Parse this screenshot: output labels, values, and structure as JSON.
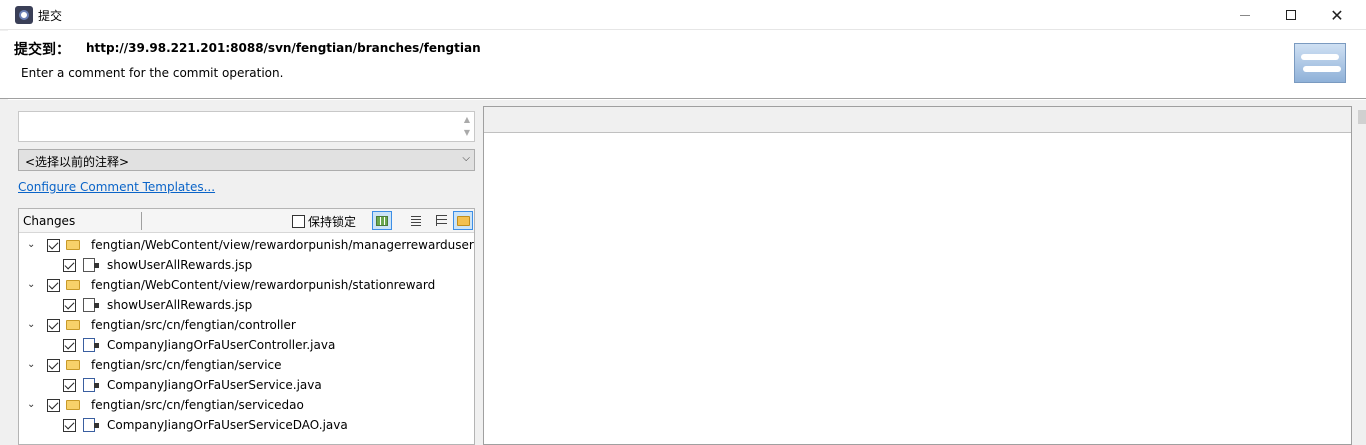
{
  "window": {
    "title": "提交"
  },
  "header": {
    "commit_to_label": "提交到：",
    "commit_url": "http://39.98.221.201:8088/svn/fengtian/branches/fengtian",
    "description": "Enter a comment for the commit operation."
  },
  "comment": {
    "value": "",
    "previous_placeholder": "<选择以前的注释>"
  },
  "links": {
    "configure_templates": "Configure Comment Templates..."
  },
  "changes": {
    "label": "Changes",
    "keep_lock_label": "保持锁定",
    "keep_lock_checked": false,
    "items": [
      {
        "type": "folder",
        "label": "fengtian/WebContent/view/rewardorpunish/managerrewarduser",
        "checked": true
      },
      {
        "type": "file",
        "label": "showUserAllRewards.jsp",
        "checked": true
      },
      {
        "type": "folder",
        "label": "fengtian/WebContent/view/rewardorpunish/stationreward",
        "checked": true
      },
      {
        "type": "file",
        "label": "showUserAllRewards.jsp",
        "checked": true
      },
      {
        "type": "folder",
        "label": "fengtian/src/cn/fengtian/controller",
        "checked": true
      },
      {
        "type": "file",
        "label": "CompanyJiangOrFaUserController.java",
        "checked": true
      },
      {
        "type": "folder",
        "label": "fengtian/src/cn/fengtian/service",
        "checked": true
      },
      {
        "type": "file",
        "label": "CompanyJiangOrFaUserService.java",
        "checked": true
      },
      {
        "type": "folder",
        "label": "fengtian/src/cn/fengtian/servicedao",
        "checked": true
      },
      {
        "type": "file",
        "label": "CompanyJiangOrFaUserServiceDAO.java",
        "checked": true
      }
    ]
  },
  "icons": {
    "app": "svn-commit-icon",
    "logo": "svn-logo"
  },
  "colors": {
    "link": "#0a64c8",
    "active_toolbar": "#cce4f7"
  }
}
